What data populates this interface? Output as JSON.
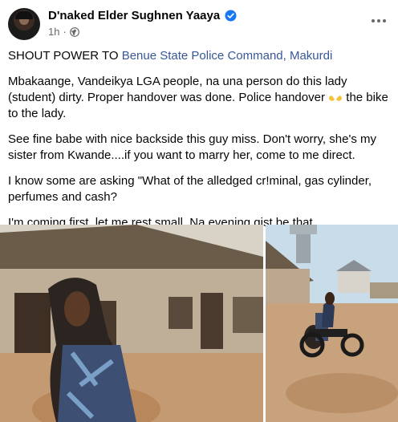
{
  "post": {
    "author": "D'naked Elder Sughnen Yaaya",
    "time": "1h",
    "dot": "·",
    "line1_prefix": "SHOUT POWER TO ",
    "line1_link": "Benue State Police Command, Makurdi",
    "para2": "Mbakaange, Vandeikya LGA people, na una person do this lady (student) dirty. Proper handover was done. Police handover",
    "para2_tail": " the bike to the lady.",
    "para3": "See fine babe with nice backside this guy miss. Don't worry, she's my sister from Kwande....if you want to marry her, come to me direct.",
    "para4": "I know some are asking \"What of the alledged cr!minal, gas cylinder, perfumes and cash?",
    "para5": "I'm coming first, let me rest small. Na evening gist be that."
  },
  "colors": {
    "link": "#385898",
    "verified": "#1877f2",
    "meta": "#65676b"
  },
  "icons": {
    "verified": "verified-badge-icon",
    "globe": "globe-icon",
    "more": "more-options-icon",
    "emoji": "open-hands-emoji"
  }
}
